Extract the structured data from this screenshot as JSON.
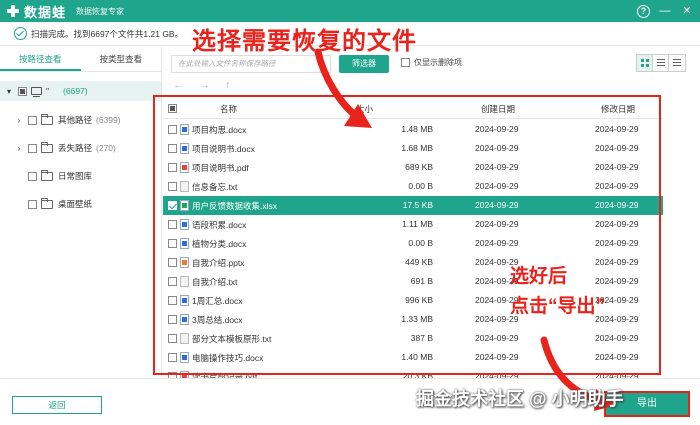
{
  "app": {
    "name": "数据蛙",
    "subtitle": "数据恢复专家",
    "help_glyph": "?",
    "minimize_glyph": "—",
    "close_glyph": "✕",
    "accent_color": "#1fa58c"
  },
  "status": {
    "text": "扫描完成。找到6697个文件共1.21 GB。"
  },
  "left_panel": {
    "tabs": [
      {
        "label": "按路径查看",
        "active": true
      },
      {
        "label": "按类型查看",
        "active": false
      }
    ],
    "tree": {
      "root": {
        "label": "\"",
        "count": "(6697)"
      },
      "children": [
        {
          "label": "其他路径",
          "count": "(6399)",
          "expandable": true
        },
        {
          "label": "丢失路径",
          "count": "(270)",
          "expandable": true
        },
        {
          "label": "日常图库",
          "count": "",
          "expandable": false
        },
        {
          "label": "桌面壁纸",
          "count": "",
          "expandable": false
        }
      ]
    }
  },
  "toolbar": {
    "search_placeholder": "在此处输入文件名称保存路径",
    "filter_label": "筛选器",
    "only_deleted_label": "仅显示删除项",
    "nav_back": "←",
    "nav_forward": "→",
    "nav_up": "↑"
  },
  "table": {
    "headers": {
      "name": "名称",
      "size": "大小",
      "created": "创建日期",
      "modified": "修改日期"
    },
    "rows": [
      {
        "name": "项目构思.docx",
        "size": "1.48 MB",
        "created": "2024-09-29",
        "modified": "2024-09-29",
        "icon": "word-file-icon",
        "selected": false
      },
      {
        "name": "项目说明书.docx",
        "size": "1.68 MB",
        "created": "2024-09-29",
        "modified": "2024-09-29",
        "icon": "word-file-icon",
        "selected": false
      },
      {
        "name": "项目说明书.pdf",
        "size": "689 KB",
        "created": "2024-09-29",
        "modified": "2024-09-29",
        "icon": "pdf-file-icon",
        "selected": false
      },
      {
        "name": "信息备忘.txt",
        "size": "0.00 B",
        "created": "2024-09-29",
        "modified": "2024-09-29",
        "icon": "text-file-icon",
        "selected": false
      },
      {
        "name": "用户反馈数据收集.xlsx",
        "size": "17.5 KB",
        "created": "2024-09-29",
        "modified": "2024-09-29",
        "icon": "excel-file-icon",
        "selected": true
      },
      {
        "name": "语段积累.docx",
        "size": "1.11 MB",
        "created": "2024-09-29",
        "modified": "2024-09-29",
        "icon": "word-file-icon",
        "selected": false
      },
      {
        "name": "植物分类.docx",
        "size": "0.00 B",
        "created": "2024-09-29",
        "modified": "2024-09-29",
        "icon": "word-file-icon",
        "selected": false
      },
      {
        "name": "自我介绍.pptx",
        "size": "449 KB",
        "created": "2024-09-29",
        "modified": "2024-09-29",
        "icon": "ppt-file-icon",
        "selected": false
      },
      {
        "name": "自我介绍.txt",
        "size": "691 B",
        "created": "2024-09-29",
        "modified": "2024-09-29",
        "icon": "text-file-icon",
        "selected": false
      },
      {
        "name": "1周汇总.docx",
        "size": "996 KB",
        "created": "2024-09-29",
        "modified": "2024-09-29",
        "icon": "word-file-icon",
        "selected": false
      },
      {
        "name": "3周总结.docx",
        "size": "1.33 MB",
        "created": "2024-09-29",
        "modified": "2024-09-29",
        "icon": "word-file-icon",
        "selected": false
      },
      {
        "name": "部分文本模板原形.txt",
        "size": "387 B",
        "created": "2024-09-29",
        "modified": "2024-09-29",
        "icon": "text-file-icon",
        "selected": false
      },
      {
        "name": "电脑操作技巧.docx",
        "size": "1.40 MB",
        "created": "2024-09-29",
        "modified": "2024-09-29",
        "icon": "word-file-icon",
        "selected": false
      },
      {
        "name": "读书片段记录.pdf",
        "size": "20.3 KB",
        "created": "2024-09-29",
        "modified": "2024-09-29",
        "icon": "pdf-file-icon",
        "selected": false
      }
    ]
  },
  "bottom": {
    "back_label": "返回",
    "export_label": "导出"
  },
  "annotations": {
    "select_files": "选择需要恢复的文件",
    "after_select_line1": "选好后",
    "after_select_line2": "点击“导出”",
    "annotation_color": "#e8231c"
  },
  "watermark": "掘金技术社区 @ 小明助手"
}
